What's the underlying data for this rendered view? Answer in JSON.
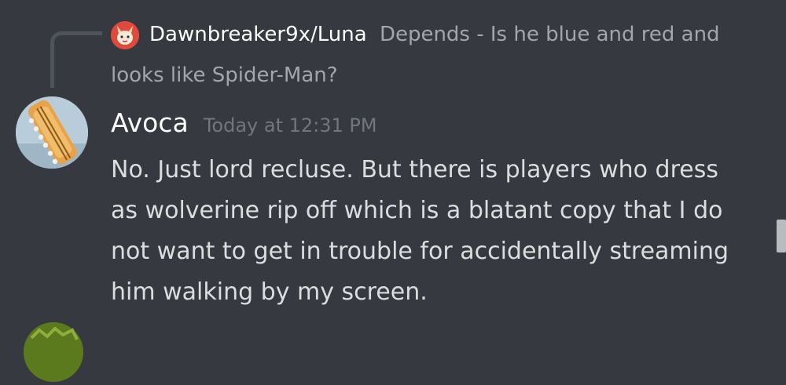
{
  "reply": {
    "author": "Dawnbreaker9x/Luna",
    "snippet_line1": "Depends - Is he blue and red and",
    "snippet_line2": "looks like Spider-Man?"
  },
  "message": {
    "author": "Avoca",
    "timestamp": "Today at 12:31 PM",
    "lines": [
      "No. Just lord recluse. But there is players who dress",
      "as wolverine rip off which is a blatant copy that I do",
      "not want to get in trouble for accidentally streaming",
      "him walking by my screen."
    ]
  },
  "colors": {
    "background": "#36393f",
    "author": "#ffffff",
    "body_text": "#dcddde",
    "muted": "#a3a6aa",
    "timestamp": "#72767d",
    "reply_spine": "#4f545c"
  },
  "icons": {
    "reply_avatar": "fox-avatar-icon",
    "avatar": "guitar-headstock-avatar",
    "next_avatar": "green-avatar-icon"
  }
}
